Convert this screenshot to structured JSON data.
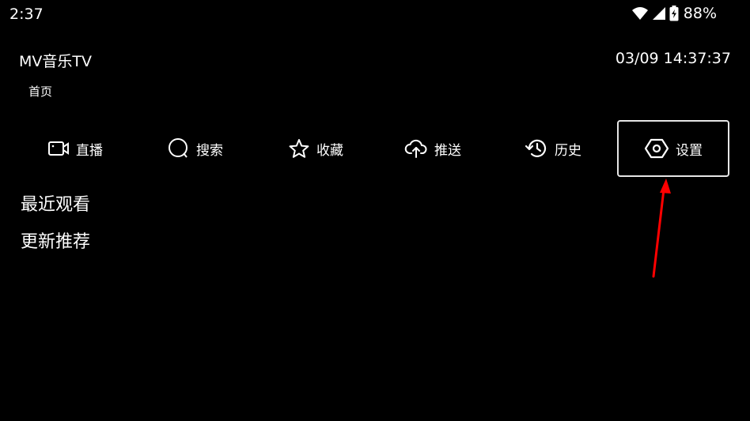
{
  "status_bar": {
    "time": "2:37",
    "battery": "88%",
    "icons": [
      "wifi-icon",
      "cell-signal-icon",
      "battery-charging-icon"
    ]
  },
  "header": {
    "app_title": "MV音乐TV",
    "datetime": "03/09 14:37:37",
    "breadcrumb": "首页"
  },
  "nav": {
    "items": [
      {
        "label": "直播",
        "icon": "video-camera-icon"
      },
      {
        "label": "搜索",
        "icon": "search-icon"
      },
      {
        "label": "收藏",
        "icon": "star-icon"
      },
      {
        "label": "推送",
        "icon": "cloud-upload-icon"
      },
      {
        "label": "历史",
        "icon": "history-icon"
      },
      {
        "label": "设置",
        "icon": "settings-icon",
        "focused": true
      }
    ]
  },
  "sections": {
    "recent": "最近观看",
    "updates": "更新推荐"
  },
  "colors": {
    "background": "#000000",
    "text": "#ffffff",
    "focus_border": "#e6e6e6",
    "annotation_arrow": "#ff0000"
  }
}
